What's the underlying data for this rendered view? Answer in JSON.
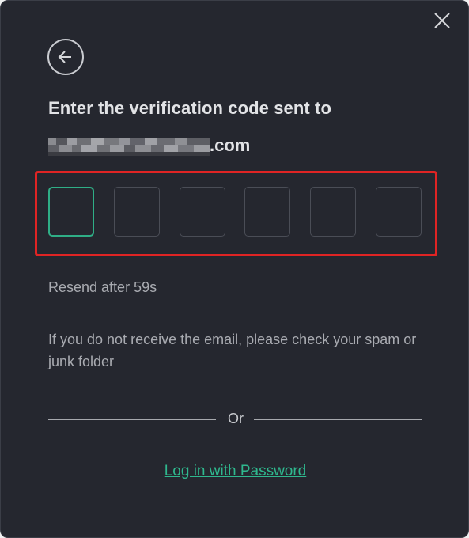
{
  "dialog": {
    "title_line1": "Enter the verification code sent to",
    "email_domain": ".com",
    "close_icon": "close-icon",
    "back_icon": "arrow-left-icon"
  },
  "code_inputs": [
    {
      "value": "",
      "active": true
    },
    {
      "value": "",
      "active": false
    },
    {
      "value": "",
      "active": false
    },
    {
      "value": "",
      "active": false
    },
    {
      "value": "",
      "active": false
    },
    {
      "value": "",
      "active": false
    }
  ],
  "resend_text": "Resend after 59s",
  "hint_text": "If you do not receive the email, please check your spam or junk folder",
  "divider_text": "Or",
  "password_link": "Log in with Password",
  "colors": {
    "background": "#25272f",
    "accent": "#2fb88e",
    "active_border": "#2fae86",
    "highlight": "#e02424"
  }
}
